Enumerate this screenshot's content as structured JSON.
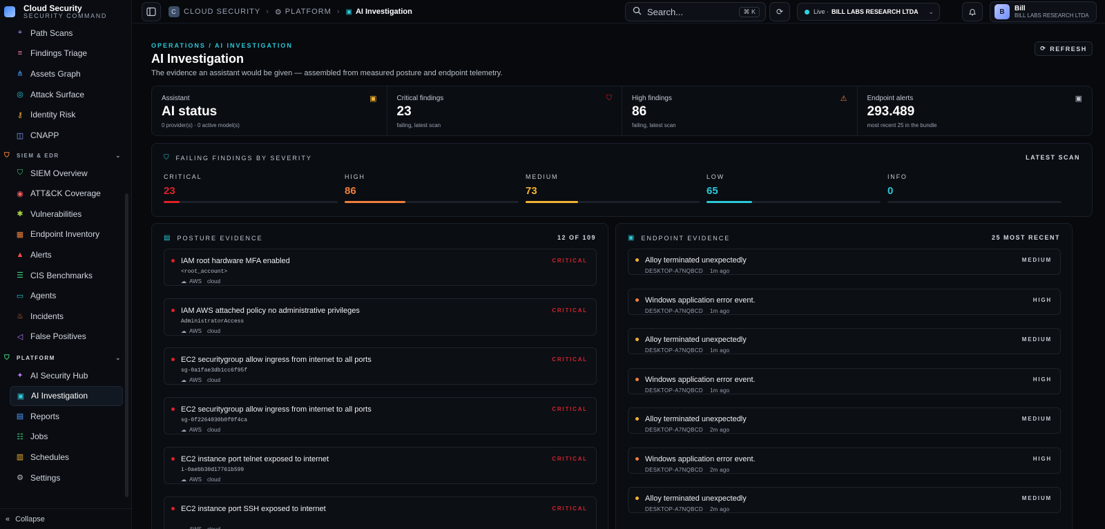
{
  "brand": {
    "name": "Cloud Security",
    "subtitle": "SECURITY COMMAND"
  },
  "sidebar": {
    "items_top": [
      {
        "label": "Path Scans",
        "icon": "path-scan-icon",
        "color": "#b48cff"
      },
      {
        "label": "Findings Triage",
        "icon": "triage-icon",
        "color": "#ff7ab6"
      },
      {
        "label": "Assets Graph",
        "icon": "graph-icon",
        "color": "#4f9dff"
      },
      {
        "label": "Attack Surface",
        "icon": "globe-icon",
        "color": "#2bc9d8"
      },
      {
        "label": "Identity Risk",
        "icon": "key-icon",
        "color": "#f2b233"
      },
      {
        "label": "CNAPP",
        "icon": "layers-icon",
        "color": "#8ca3ff"
      }
    ],
    "section_siem": {
      "label": "SIEM & EDR",
      "color": "#f07f3c"
    },
    "items_siem": [
      {
        "label": "SIEM Overview",
        "icon": "shield-check-icon",
        "color": "#3fd17a"
      },
      {
        "label": "ATT&CK Coverage",
        "icon": "target-icon",
        "color": "#ff5c5c"
      },
      {
        "label": "Vulnerabilities",
        "icon": "bug-icon",
        "color": "#a8d43f"
      },
      {
        "label": "Endpoint Inventory",
        "icon": "box-icon",
        "color": "#f07f3c"
      },
      {
        "label": "Alerts",
        "icon": "siren-icon",
        "color": "#ff4b4b"
      },
      {
        "label": "CIS Benchmarks",
        "icon": "list-check-icon",
        "color": "#3fd17a"
      },
      {
        "label": "Agents",
        "icon": "monitor-icon",
        "color": "#2bc9d8"
      },
      {
        "label": "Incidents",
        "icon": "flame-icon",
        "color": "#ff7a3c"
      },
      {
        "label": "False Positives",
        "icon": "mute-icon",
        "color": "#c07cff"
      }
    ],
    "section_platform": {
      "label": "PLATFORM",
      "color": "#3fd17a"
    },
    "items_platform": [
      {
        "label": "AI Security Hub",
        "icon": "sparkle-icon",
        "color": "#c07cff"
      },
      {
        "label": "AI Investigation",
        "icon": "bot-icon",
        "color": "#2bc9d8",
        "active": true
      },
      {
        "label": "Reports",
        "icon": "report-icon",
        "color": "#4f9dff"
      },
      {
        "label": "Jobs",
        "icon": "jobs-icon",
        "color": "#3fd17a"
      },
      {
        "label": "Schedules",
        "icon": "calendar-icon",
        "color": "#f2b233"
      },
      {
        "label": "Settings",
        "icon": "gear-icon",
        "color": "#b9c0ca"
      }
    ],
    "collapse_label": "Collapse"
  },
  "topbar": {
    "crumbs": [
      "CLOUD SECURITY",
      "PLATFORM",
      "AI Investigation"
    ],
    "crumb_logo": "C",
    "search_placeholder": "Search...",
    "search_kbd": "⌘ K",
    "live_label": "Live ·",
    "org": "BILL LABS RESEARCH LTDA",
    "user_initial": "B",
    "user_name": "Bill",
    "user_org": "BILL LABS RESEARCH LTDA"
  },
  "page": {
    "eyebrow": "OPERATIONS / AI INVESTIGATION",
    "title": "AI Investigation",
    "subtitle": "The evidence an assistant would be given — assembled from measured posture and endpoint telemetry.",
    "refresh_label": "REFRESH"
  },
  "stats": [
    {
      "label": "Assistant",
      "value": "AI status",
      "sub": "0 provider(s) · 0 active model(s)",
      "icon": "bot-icon",
      "color": "#f2b233"
    },
    {
      "label": "Critical findings",
      "value": "23",
      "sub": "failing, latest scan",
      "icon": "shield-alert-icon",
      "color": "#e0202a"
    },
    {
      "label": "High findings",
      "value": "86",
      "sub": "failing, latest scan",
      "icon": "warning-icon",
      "color": "#f07f3c"
    },
    {
      "label": "Endpoint alerts",
      "value": "293.489",
      "sub": "most recent 25 in the bundle",
      "icon": "chip-icon",
      "color": "#b9c0ca"
    }
  ],
  "severity": {
    "title": "FAILING FINDINGS BY SEVERITY",
    "right_label": "LATEST SCAN",
    "levels": [
      {
        "label": "CRITICAL",
        "value": "23",
        "color": "#e0202a",
        "fill_fraction": 0.09
      },
      {
        "label": "HIGH",
        "value": "86",
        "color": "#f07f3c",
        "fill_fraction": 0.35
      },
      {
        "label": "MEDIUM",
        "value": "73",
        "color": "#f2b233",
        "fill_fraction": 0.3
      },
      {
        "label": "LOW",
        "value": "65",
        "color": "#2bc9d8",
        "fill_fraction": 0.26
      },
      {
        "label": "INFO",
        "value": "0",
        "color": "#2bc9d8",
        "fill_fraction": 0
      }
    ]
  },
  "posture": {
    "title": "POSTURE EVIDENCE",
    "count": "12 OF 109",
    "items": [
      {
        "title": "IAM root hardware MFA enabled",
        "resource": "<root_account>",
        "provider": "AWS",
        "kind": "cloud",
        "severity": "CRITICAL"
      },
      {
        "title": "IAM AWS attached policy no administrative privileges",
        "resource": "AdministratorAccess",
        "provider": "AWS",
        "kind": "cloud",
        "severity": "CRITICAL"
      },
      {
        "title": "EC2 securitygroup allow ingress from internet to all ports",
        "resource": "sg-0a1fae3db1cc6f95f",
        "provider": "AWS",
        "kind": "cloud",
        "severity": "CRITICAL"
      },
      {
        "title": "EC2 securitygroup allow ingress from internet to all ports",
        "resource": "sg-0f2264030b0f0f4ca",
        "provider": "AWS",
        "kind": "cloud",
        "severity": "CRITICAL"
      },
      {
        "title": "EC2 instance port telnet exposed to internet",
        "resource": "i-0aebb30d17761b599",
        "provider": "AWS",
        "kind": "cloud",
        "severity": "CRITICAL"
      },
      {
        "title": "EC2 instance port SSH exposed to internet",
        "resource": "",
        "provider": "AWS",
        "kind": "cloud",
        "severity": "CRITICAL"
      }
    ]
  },
  "endpoint": {
    "title": "ENDPOINT EVIDENCE",
    "count": "25 MOST RECENT",
    "items": [
      {
        "title": "Alloy terminated unexpectedly",
        "host": "DESKTOP-A7NQBCD",
        "time": "1m ago",
        "severity": "MEDIUM",
        "color": "#f2b233"
      },
      {
        "title": "Windows application error event.",
        "host": "DESKTOP-A7NQBCD",
        "time": "1m ago",
        "severity": "HIGH",
        "color": "#f07f3c"
      },
      {
        "title": "Alloy terminated unexpectedly",
        "host": "DESKTOP-A7NQBCD",
        "time": "1m ago",
        "severity": "MEDIUM",
        "color": "#f2b233"
      },
      {
        "title": "Windows application error event.",
        "host": "DESKTOP-A7NQBCD",
        "time": "1m ago",
        "severity": "HIGH",
        "color": "#f07f3c"
      },
      {
        "title": "Alloy terminated unexpectedly",
        "host": "DESKTOP-A7NQBCD",
        "time": "2m ago",
        "severity": "MEDIUM",
        "color": "#f2b233"
      },
      {
        "title": "Windows application error event.",
        "host": "DESKTOP-A7NQBCD",
        "time": "2m ago",
        "severity": "HIGH",
        "color": "#f07f3c"
      },
      {
        "title": "Alloy terminated unexpectedly",
        "host": "DESKTOP-A7NQBCD",
        "time": "2m ago",
        "severity": "MEDIUM",
        "color": "#f2b233"
      }
    ]
  }
}
